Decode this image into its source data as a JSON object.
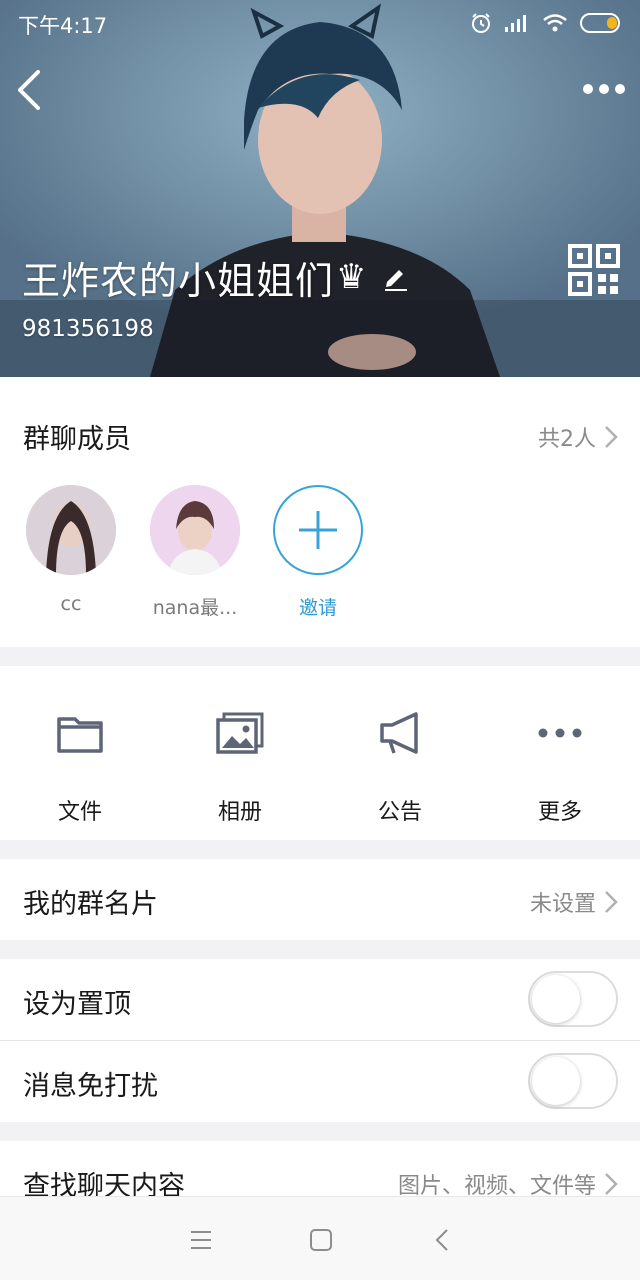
{
  "status_bar": {
    "time": "下午4:17",
    "icons": [
      "alarm-icon",
      "signal-icon",
      "wifi-icon",
      "battery-icon"
    ]
  },
  "header": {
    "group_name": "王炸农的小姐姐们",
    "crown_glyph": "♛",
    "group_id": "981356198"
  },
  "members": {
    "title": "群聊成员",
    "count_label": "共2人",
    "items": [
      {
        "name": "cc"
      },
      {
        "name": "nana最..."
      }
    ],
    "invite_label": "邀请"
  },
  "actions": [
    {
      "label": "文件",
      "icon": "folder-icon"
    },
    {
      "label": "相册",
      "icon": "album-icon"
    },
    {
      "label": "公告",
      "icon": "announcement-icon"
    },
    {
      "label": "更多",
      "icon": "more-icon"
    }
  ],
  "rows": {
    "card": {
      "label": "我的群名片",
      "value": "未设置"
    },
    "pin": {
      "label": "设为置顶",
      "on": false
    },
    "mute": {
      "label": "消息免打扰",
      "on": false
    },
    "search": {
      "label": "查找聊天内容",
      "value": "图片、视频、文件等"
    }
  },
  "colors": {
    "accent": "#37a4d9",
    "icon_gray": "#5d6576"
  }
}
